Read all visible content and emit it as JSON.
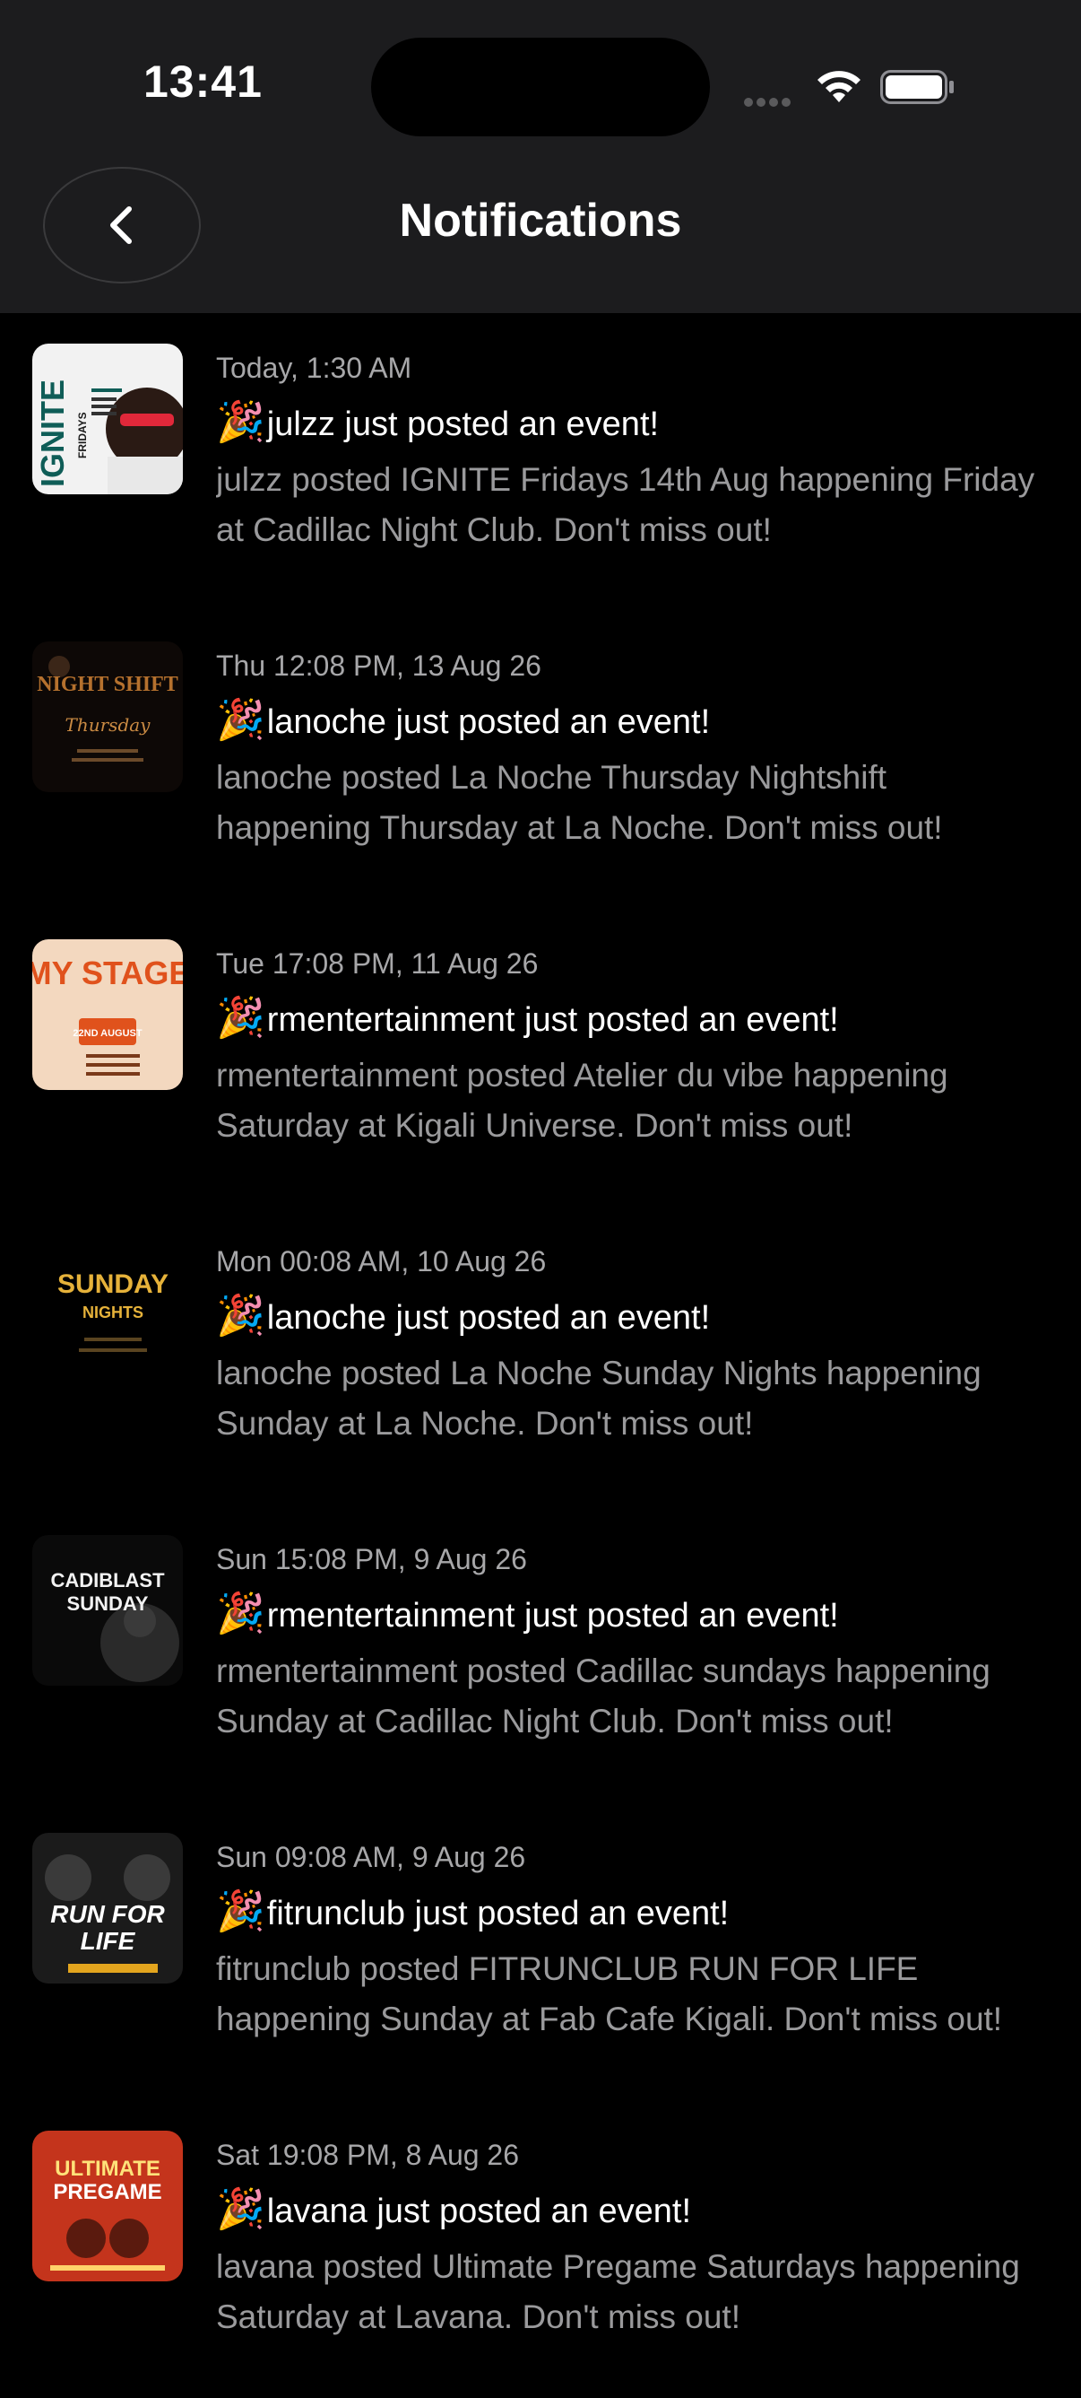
{
  "status_bar": {
    "time": "13:41"
  },
  "header": {
    "title": "Notifications"
  },
  "notifications": [
    {
      "time": "Today, 1:30 AM",
      "emoji": "🎉",
      "headline": "julzz just posted an event!",
      "body": "julzz posted IGNITE Fridays 14th Aug happening Friday at Cadillac Night Club. Don't miss out!",
      "thumb_title": "IGNITE",
      "thumb_sub": "FRIDAYS"
    },
    {
      "time": "Thu 12:08 PM, 13 Aug 26",
      "emoji": "🎉",
      "headline": "lanoche just posted an event!",
      "body": "lanoche posted La Noche Thursday Nightshift happening Thursday at La Noche. Don't miss out!",
      "thumb_title": "NIGHT SHIFT",
      "thumb_sub": "Thursday"
    },
    {
      "time": "Tue 17:08 PM, 11 Aug 26",
      "emoji": "🎉",
      "headline": "rmentertainment just posted an event!",
      "body": "rmentertainment posted Atelier du vibe happening Saturday at Kigali Universe. Don't miss out!",
      "thumb_title": "MY STAGE",
      "thumb_sub": "22ND AUGUST"
    },
    {
      "time": "Mon 00:08 AM, 10 Aug 26",
      "emoji": "🎉",
      "headline": "lanoche just posted an event!",
      "body": "lanoche posted La Noche Sunday Nights happening Sunday at La Noche. Don't miss out!",
      "thumb_title": "SUNDAY",
      "thumb_sub": "NIGHTS"
    },
    {
      "time": "Sun 15:08 PM, 9 Aug 26",
      "emoji": "🎉",
      "headline": "rmentertainment just posted an event!",
      "body": "rmentertainment posted Cadillac sundays happening Sunday at Cadillac Night Club. Don't miss out!",
      "thumb_title": "CADIBLAST",
      "thumb_sub": "SUNDAY"
    },
    {
      "time": "Sun 09:08 AM, 9 Aug 26",
      "emoji": "🎉",
      "headline": "fitrunclub just posted an event!",
      "body": "fitrunclub posted FITRUNCLUB RUN FOR LIFE happening Sunday at Fab Cafe Kigali. Don't miss out!",
      "thumb_title": "RUN FOR",
      "thumb_sub": "LIFE"
    },
    {
      "time": "Sat 19:08 PM, 8 Aug 26",
      "emoji": "🎉",
      "headline": "lavana just posted an event!",
      "body": "lavana posted Ultimate Pregame Saturdays happening Saturday at Lavana. Don't miss out!",
      "thumb_title": "ULTIMATE",
      "thumb_sub": "PREGAME"
    }
  ]
}
